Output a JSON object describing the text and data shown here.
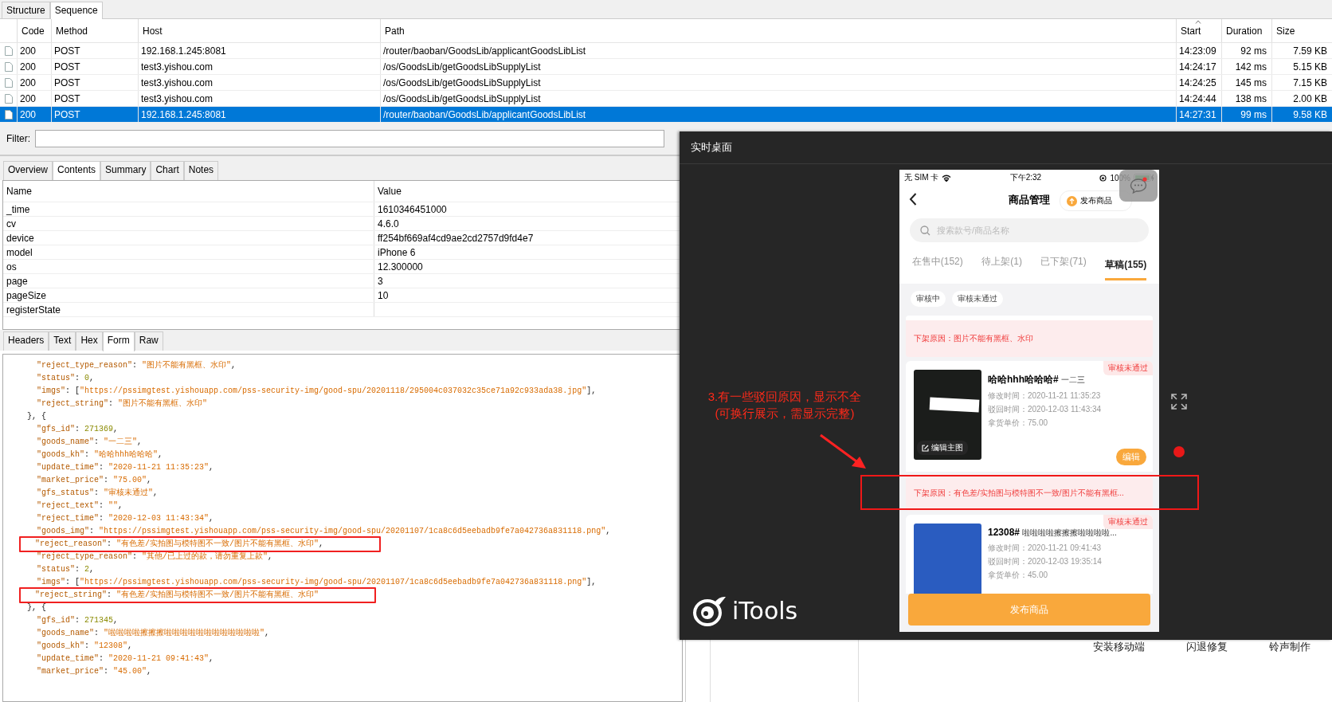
{
  "top_tabs": [
    {
      "label": "Structure",
      "selected": false
    },
    {
      "label": "Sequence",
      "selected": true
    }
  ],
  "requests": {
    "columns": [
      "Code",
      "Method",
      "Host",
      "Path",
      "Start",
      "Duration",
      "Size"
    ],
    "rows": [
      {
        "code": "200",
        "method": "POST",
        "host": "192.168.1.245:8081",
        "path": "/router/baoban/GoodsLib/applicantGoodsLibList",
        "start": "14:23:09",
        "duration": "92 ms",
        "size": "7.59 KB",
        "selected": false
      },
      {
        "code": "200",
        "method": "POST",
        "host": "test3.yishou.com",
        "path": "/os/GoodsLib/getGoodsLibSupplyList",
        "start": "14:24:17",
        "duration": "142 ms",
        "size": "5.15 KB",
        "selected": false
      },
      {
        "code": "200",
        "method": "POST",
        "host": "test3.yishou.com",
        "path": "/os/GoodsLib/getGoodsLibSupplyList",
        "start": "14:24:25",
        "duration": "145 ms",
        "size": "7.15 KB",
        "selected": false
      },
      {
        "code": "200",
        "method": "POST",
        "host": "test3.yishou.com",
        "path": "/os/GoodsLib/getGoodsLibSupplyList",
        "start": "14:24:44",
        "duration": "138 ms",
        "size": "2.00 KB",
        "selected": false
      },
      {
        "code": "200",
        "method": "POST",
        "host": "192.168.1.245:8081",
        "path": "/router/baoban/GoodsLib/applicantGoodsLibList",
        "start": "14:27:31",
        "duration": "99 ms",
        "size": "9.58 KB",
        "selected": true
      }
    ]
  },
  "filter": {
    "label": "Filter:"
  },
  "detail_tabs": [
    {
      "label": "Overview",
      "selected": false
    },
    {
      "label": "Contents",
      "selected": true
    },
    {
      "label": "Summary",
      "selected": false
    },
    {
      "label": "Chart",
      "selected": false
    },
    {
      "label": "Notes",
      "selected": false
    }
  ],
  "form_table": {
    "columns": [
      "Name",
      "Value"
    ],
    "rows": [
      {
        "name": "_time",
        "value": "1610346451000"
      },
      {
        "name": "cv",
        "value": "4.6.0"
      },
      {
        "name": "device",
        "value": "ff254bf669af4cd9ae2cd2757d9fd4e7"
      },
      {
        "name": "model",
        "value": "iPhone 6"
      },
      {
        "name": "os",
        "value": "12.300000"
      },
      {
        "name": "page",
        "value": "3"
      },
      {
        "name": "pageSize",
        "value": "10"
      },
      {
        "name": "registerState"
      }
    ]
  },
  "body_tabs": [
    {
      "label": "Headers",
      "selected": false
    },
    {
      "label": "Text",
      "selected": false
    },
    {
      "label": "Hex",
      "selected": false
    },
    {
      "label": "Form",
      "selected": true
    },
    {
      "label": "Raw",
      "selected": false
    }
  ],
  "body_lines": [
    {
      "kind": "field",
      "boxed": false,
      "parts": [
        {
          "kind": "key",
          "text": "\"reject_type_reason\""
        },
        {
          "kind": "punct",
          "text": ": "
        },
        {
          "kind": "string",
          "text": "\"图片不能有黑框、水印\""
        },
        {
          "kind": "punct",
          "text": ","
        }
      ]
    },
    {
      "kind": "field",
      "boxed": false,
      "parts": [
        {
          "kind": "key",
          "text": "\"status\""
        },
        {
          "kind": "punct",
          "text": ": "
        },
        {
          "kind": "number",
          "text": "0"
        },
        {
          "kind": "punct",
          "text": ","
        }
      ]
    },
    {
      "kind": "field",
      "boxed": false,
      "parts": [
        {
          "kind": "key",
          "text": "\"imgs\""
        },
        {
          "kind": "punct",
          "text": ": ["
        },
        {
          "kind": "string",
          "text": "\"https://pssimgtest.yishouapp.com/pss-security-img/good-spu/20201118/295004c037032c35ce71a92c933ada38.jpg\""
        },
        {
          "kind": "punct",
          "text": "],"
        }
      ]
    },
    {
      "kind": "field",
      "boxed": false,
      "parts": [
        {
          "kind": "key",
          "text": "\"reject_string\""
        },
        {
          "kind": "punct",
          "text": ": "
        },
        {
          "kind": "string",
          "text": "\"图片不能有黑框、水印\""
        }
      ]
    },
    {
      "kind": "brace",
      "boxed": false,
      "parts": [
        {
          "kind": "punct",
          "text": "}, {"
        }
      ]
    },
    {
      "kind": "field",
      "boxed": false,
      "parts": [
        {
          "kind": "key",
          "text": "\"gfs_id\""
        },
        {
          "kind": "punct",
          "text": ": "
        },
        {
          "kind": "number",
          "text": "271369"
        },
        {
          "kind": "punct",
          "text": ","
        }
      ]
    },
    {
      "kind": "field",
      "boxed": false,
      "parts": [
        {
          "kind": "key",
          "text": "\"goods_name\""
        },
        {
          "kind": "punct",
          "text": ": "
        },
        {
          "kind": "string",
          "text": "\"一二三\""
        },
        {
          "kind": "punct",
          "text": ","
        }
      ]
    },
    {
      "kind": "field",
      "boxed": false,
      "parts": [
        {
          "kind": "key",
          "text": "\"goods_kh\""
        },
        {
          "kind": "punct",
          "text": ": "
        },
        {
          "kind": "string",
          "text": "\"哈哈hhh哈哈哈\""
        },
        {
          "kind": "punct",
          "text": ","
        }
      ]
    },
    {
      "kind": "field",
      "boxed": false,
      "parts": [
        {
          "kind": "key",
          "text": "\"update_time\""
        },
        {
          "kind": "punct",
          "text": ": "
        },
        {
          "kind": "string",
          "text": "\"2020-11-21 11:35:23\""
        },
        {
          "kind": "punct",
          "text": ","
        }
      ]
    },
    {
      "kind": "field",
      "boxed": false,
      "parts": [
        {
          "kind": "key",
          "text": "\"market_price\""
        },
        {
          "kind": "punct",
          "text": ": "
        },
        {
          "kind": "string",
          "text": "\"75.00\""
        },
        {
          "kind": "punct",
          "text": ","
        }
      ]
    },
    {
      "kind": "field",
      "boxed": false,
      "parts": [
        {
          "kind": "key",
          "text": "\"gfs_status\""
        },
        {
          "kind": "punct",
          "text": ": "
        },
        {
          "kind": "string",
          "text": "\"审核未通过\""
        },
        {
          "kind": "punct",
          "text": ","
        }
      ]
    },
    {
      "kind": "field",
      "boxed": false,
      "parts": [
        {
          "kind": "key",
          "text": "\"reject_text\""
        },
        {
          "kind": "punct",
          "text": ": "
        },
        {
          "kind": "string",
          "text": "\"\""
        },
        {
          "kind": "punct",
          "text": ","
        }
      ]
    },
    {
      "kind": "field",
      "boxed": false,
      "parts": [
        {
          "kind": "key",
          "text": "\"reject_time\""
        },
        {
          "kind": "punct",
          "text": ": "
        },
        {
          "kind": "string",
          "text": "\"2020-12-03 11:43:34\""
        },
        {
          "kind": "punct",
          "text": ","
        }
      ]
    },
    {
      "kind": "field",
      "boxed": false,
      "parts": [
        {
          "kind": "key",
          "text": "\"goods_img\""
        },
        {
          "kind": "punct",
          "text": ": "
        },
        {
          "kind": "string",
          "text": "\"https://pssimgtest.yishouapp.com/pss-security-img/good-spu/20201107/1ca8c6d5eebadb9fe7a042736a831118.png\""
        },
        {
          "kind": "punct",
          "text": ","
        }
      ]
    },
    {
      "kind": "field",
      "boxed": true,
      "parts": [
        {
          "kind": "key",
          "text": "\"reject_reason\""
        },
        {
          "kind": "punct",
          "text": ": "
        },
        {
          "kind": "string",
          "text": "\"有色差/实拍图与模特图不一致/图片不能有黑框、水印\""
        },
        {
          "kind": "punct",
          "text": ","
        }
      ]
    },
    {
      "kind": "field",
      "boxed": false,
      "parts": [
        {
          "kind": "key",
          "text": "\"reject_type_reason\""
        },
        {
          "kind": "punct",
          "text": ": "
        },
        {
          "kind": "string",
          "text": "\"其他/已上过的款，请勿重复上款\""
        },
        {
          "kind": "punct",
          "text": ","
        }
      ]
    },
    {
      "kind": "field",
      "boxed": false,
      "parts": [
        {
          "kind": "key",
          "text": "\"status\""
        },
        {
          "kind": "punct",
          "text": ": "
        },
        {
          "kind": "number",
          "text": "2"
        },
        {
          "kind": "punct",
          "text": ","
        }
      ]
    },
    {
      "kind": "field",
      "boxed": false,
      "parts": [
        {
          "kind": "key",
          "text": "\"imgs\""
        },
        {
          "kind": "punct",
          "text": ": ["
        },
        {
          "kind": "string",
          "text": "\"https://pssimgtest.yishouapp.com/pss-security-img/good-spu/20201107/1ca8c6d5eebadb9fe7a042736a831118.png\""
        },
        {
          "kind": "punct",
          "text": "],"
        }
      ]
    },
    {
      "kind": "field",
      "boxed": true,
      "parts": [
        {
          "kind": "key",
          "text": "\"reject_string\""
        },
        {
          "kind": "punct",
          "text": ": "
        },
        {
          "kind": "string",
          "text": "\"有色差/实拍图与模特图不一致/图片不能有黑框、水印\""
        }
      ]
    },
    {
      "kind": "brace",
      "boxed": false,
      "parts": [
        {
          "kind": "punct",
          "text": "}, {"
        }
      ]
    },
    {
      "kind": "field",
      "boxed": false,
      "parts": [
        {
          "kind": "key",
          "text": "\"gfs_id\""
        },
        {
          "kind": "punct",
          "text": ": "
        },
        {
          "kind": "number",
          "text": "271345"
        },
        {
          "kind": "punct",
          "text": ","
        }
      ]
    },
    {
      "kind": "field",
      "boxed": false,
      "parts": [
        {
          "kind": "key",
          "text": "\"goods_name\""
        },
        {
          "kind": "punct",
          "text": ": "
        },
        {
          "kind": "string",
          "text": "\"啦啦啦啦擦擦擦啦啦啦啦啦啦啦啦啦啦啦啦\""
        },
        {
          "kind": "punct",
          "text": ","
        }
      ]
    },
    {
      "kind": "field",
      "boxed": false,
      "parts": [
        {
          "kind": "key",
          "text": "\"goods_kh\""
        },
        {
          "kind": "punct",
          "text": ": "
        },
        {
          "kind": "string",
          "text": "\"12308\""
        },
        {
          "kind": "punct",
          "text": ","
        }
      ]
    },
    {
      "kind": "field",
      "boxed": false,
      "parts": [
        {
          "kind": "key",
          "text": "\"update_time\""
        },
        {
          "kind": "punct",
          "text": ": "
        },
        {
          "kind": "string",
          "text": "\"2020-11-21 09:41:43\""
        },
        {
          "kind": "punct",
          "text": ","
        }
      ]
    },
    {
      "kind": "field",
      "boxed": false,
      "parts": [
        {
          "kind": "key",
          "text": "\"market_price\""
        },
        {
          "kind": "punct",
          "text": ": "
        },
        {
          "kind": "string",
          "text": "\"45.00\""
        },
        {
          "kind": "punct",
          "text": ","
        }
      ]
    }
  ],
  "live_desktop": {
    "title": "实时桌面",
    "annotation": [
      "3.有一些驳回原因，显示不全",
      "(可换行展示，需显示完整)"
    ],
    "logo_text": "iTools",
    "phone": {
      "status_bar": {
        "carrier": "无 SIM 卡",
        "time": "下午2:32",
        "battery": "100%"
      },
      "title": "商品管理",
      "publish_chip": "发布商品",
      "search_placeholder": "搜索款号/商品名称",
      "tabs": [
        {
          "label": "在售中(152)",
          "selected": false
        },
        {
          "label": "待上架(1)",
          "selected": false
        },
        {
          "label": "已下架(71)",
          "selected": false
        },
        {
          "label": "草稿(155)",
          "selected": true
        }
      ],
      "filter_chips": [
        "审核中",
        "审核未通过"
      ],
      "list": [
        {
          "kind": "reason",
          "text": "下架原因：图片不能有黑框、水印"
        },
        {
          "kind": "product",
          "color": "#1b1d1b",
          "code": "哈哈hhh哈哈哈#",
          "name": "一二三",
          "details": [
            "修改时间：2020-11-21 11:35:23",
            "驳回时间：2020-12-03 11:43:34",
            "拿货单价：75.00"
          ],
          "status": "审核未通过",
          "image_label": "编辑主图",
          "edit": "编辑"
        },
        {
          "kind": "reason",
          "text": "下架原因：有色差/实拍图与模特图不一致/图片不能有黑框..."
        },
        {
          "kind": "product",
          "color": "#2a5cc0",
          "code": "12308#",
          "name": "啦啦啦啦擦擦擦啦啦啦啦...",
          "details": [
            "修改时间：2020-11-21 09:41:43",
            "驳回时间：2020-12-03 19:35:14",
            "拿货单价：45.00"
          ],
          "status": "审核未通过"
        }
      ],
      "publish_button": "发布商品"
    }
  },
  "desktop_links": [
    "安装移动端",
    "闪退修复",
    "铃声制作"
  ]
}
